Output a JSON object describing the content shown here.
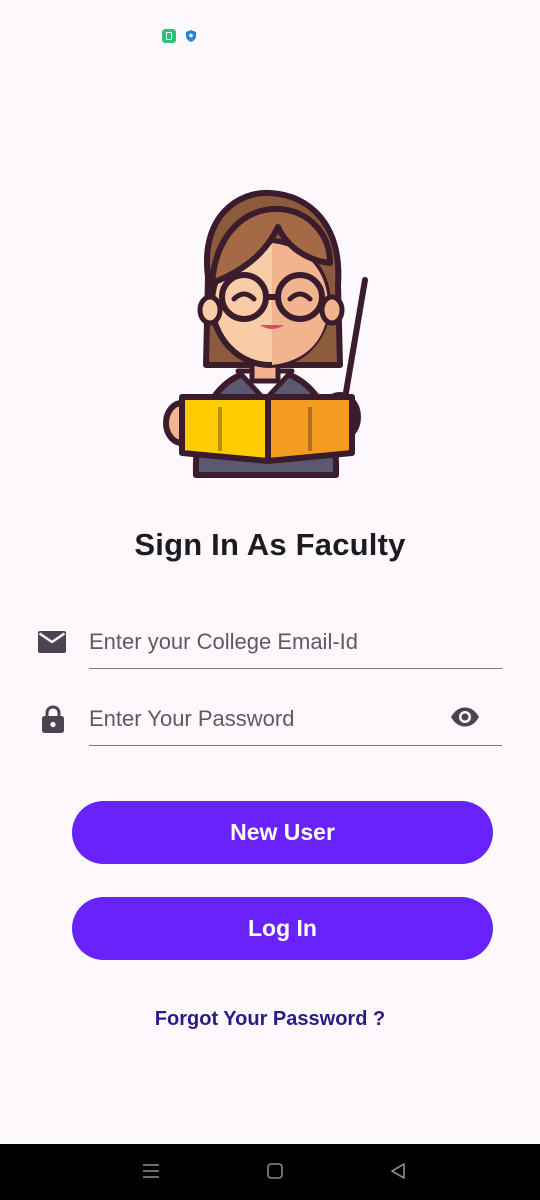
{
  "status_bar": {
    "icons": [
      "app-notification-icon",
      "shield-icon"
    ]
  },
  "page": {
    "title": "Sign In As Faculty",
    "illustration": "teacher-with-book-and-pointer"
  },
  "form": {
    "email": {
      "icon": "mail-icon",
      "placeholder": "Enter your College Email-Id",
      "value": ""
    },
    "password": {
      "icon": "lock-icon",
      "placeholder": "Enter Your Password",
      "value": "",
      "toggle_icon": "eye-icon"
    }
  },
  "buttons": {
    "new_user_label": "New User",
    "login_label": "Log In"
  },
  "links": {
    "forgot_password": "Forgot Your Password ?"
  },
  "nav_bar": {
    "icons": [
      "menu-icon",
      "home-square-icon",
      "back-triangle-icon"
    ]
  },
  "colors": {
    "background": "#fdf8fc",
    "primary": "#6a22fb",
    "link": "#2a1b8a",
    "title": "#1c1b1f",
    "nav_bar": "#000000"
  }
}
